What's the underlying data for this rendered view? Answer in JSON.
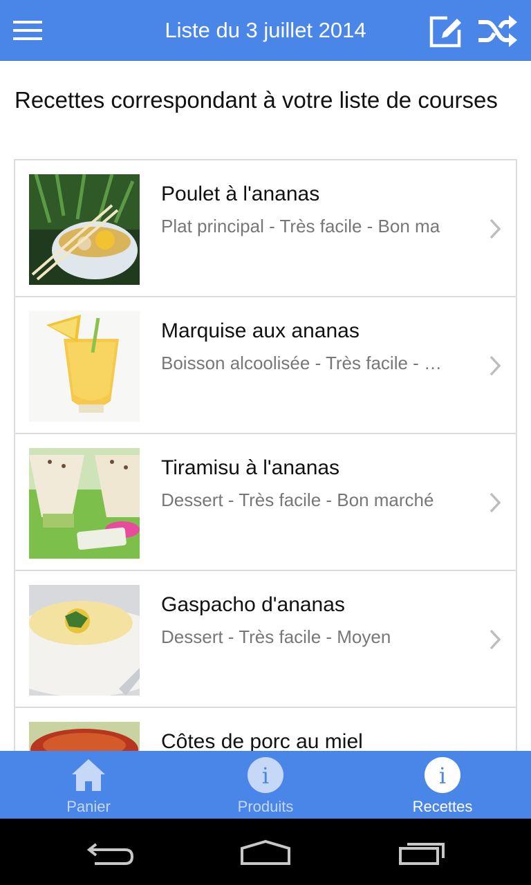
{
  "app_bar": {
    "title": "Liste du 3 juillet 2014",
    "icons": [
      "menu-icon",
      "edit-icon",
      "shuffle-icon"
    ]
  },
  "main": {
    "heading": "Recettes correspondant à votre liste de courses",
    "recipes": [
      {
        "name": "Poulet à l'ananas",
        "meta": "Plat principal - Très facile - Bon ma"
      },
      {
        "name": "Marquise aux ananas",
        "meta": "Boisson alcoolisée - Très facile - …"
      },
      {
        "name": "Tiramisu à l'ananas",
        "meta": "Dessert - Très facile - Bon marché"
      },
      {
        "name": "Gaspacho d'ananas",
        "meta": "Dessert - Très facile - Moyen"
      },
      {
        "name": "Côtes de porc au miel",
        "meta": ""
      }
    ]
  },
  "bottom_nav": {
    "items": [
      {
        "label": "Panier",
        "icon": "home-icon"
      },
      {
        "label": "Produits",
        "icon": "info-icon"
      },
      {
        "label": "Recettes",
        "icon": "info-icon",
        "active": true
      }
    ]
  },
  "colors": {
    "primary": "#4a86e8",
    "nav_inactive": "#c5d8f7",
    "nav_active": "#ffffff",
    "meta_text": "#777777"
  },
  "system_nav": [
    "back-icon",
    "home-outline-icon",
    "recents-icon"
  ]
}
